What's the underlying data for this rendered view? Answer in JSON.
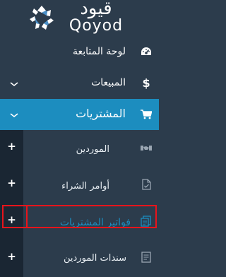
{
  "brand": {
    "name_arabic": "قيود",
    "name_latin": "Qoyod"
  },
  "sidebar": {
    "items": [
      {
        "label": "لوحة المتابعة",
        "icon": "dashboard-gauge-icon"
      },
      {
        "label": "المبيعات",
        "icon": "dollar-icon",
        "expandable": true
      },
      {
        "label": "المشتريات",
        "icon": "cart-icon",
        "expandable": true,
        "active": true
      }
    ],
    "submenu": [
      {
        "label": "الموردين",
        "icon": "suppliers-icon",
        "action": "+"
      },
      {
        "label": "أوامر الشراء",
        "icon": "purchase-order-icon",
        "action": "+"
      },
      {
        "label": "فواتير المشتريات",
        "icon": "purchase-invoices-icon",
        "action": "+",
        "highlighted": true
      },
      {
        "label": "سندات الموردين",
        "icon": "supplier-vouchers-icon",
        "action": "+"
      }
    ]
  },
  "colors": {
    "sidebar_bg": "#2c3c4c",
    "active_bg": "#1c8dbf",
    "rail_bg": "#1a2633",
    "highlight_accent": "#1c8dbf",
    "annotation_red": "#e8141b",
    "text": "#ffffff"
  }
}
